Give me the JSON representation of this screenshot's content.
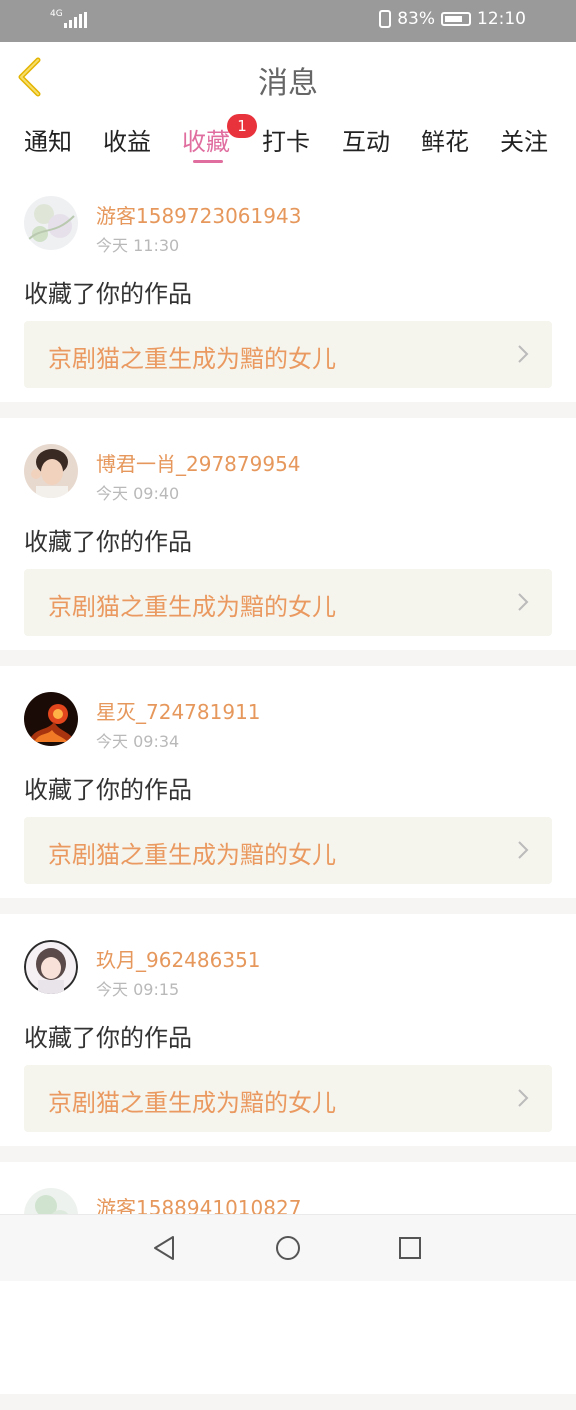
{
  "status_bar": {
    "network": "4G",
    "battery": "83%",
    "time": "12:10"
  },
  "header": {
    "title": "消息"
  },
  "tabs": [
    {
      "label": "通知"
    },
    {
      "label": "收益"
    },
    {
      "label": "收藏",
      "badge": "1",
      "active": true
    },
    {
      "label": "打卡"
    },
    {
      "label": "互动"
    },
    {
      "label": "鲜花"
    },
    {
      "label": "关注"
    }
  ],
  "messages": [
    {
      "username": "游客1589723061943",
      "time": "今天 11:30",
      "action": "收藏了你的作品",
      "work": "京剧猫之重生成为黯的女儿",
      "avatar_icon": "floral-avatar"
    },
    {
      "username": "博君一肖_297879954",
      "time": "今天 09:40",
      "action": "收藏了你的作品",
      "work": "京剧猫之重生成为黯的女儿",
      "avatar_icon": "person-avatar"
    },
    {
      "username": "星灭_724781911",
      "time": "今天 09:34",
      "action": "收藏了你的作品",
      "work": "京剧猫之重生成为黯的女儿",
      "avatar_icon": "fire-avatar"
    },
    {
      "username": "玖月_962486351",
      "time": "今天 09:15",
      "action": "收藏了你的作品",
      "work": "京剧猫之重生成为黯的女儿",
      "avatar_icon": "anime-girl-avatar"
    },
    {
      "username": "游客1588941010827",
      "avatar_icon": "floral-avatar"
    }
  ],
  "colors": {
    "accent": "#e06fa0",
    "username": "#e6985c",
    "work_title": "#ea9a60",
    "badge": "#e8333c",
    "back_arrow": "#e3b400"
  }
}
